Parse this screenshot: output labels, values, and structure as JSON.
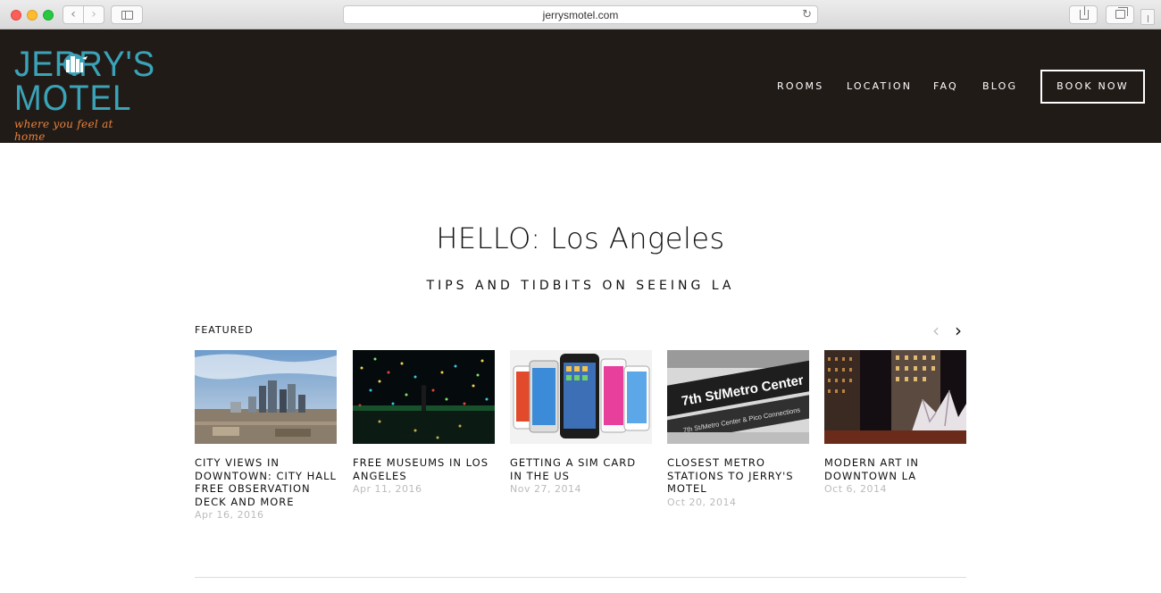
{
  "browser": {
    "url": "jerrysmotel.com",
    "back_icon": "chevron-left-icon",
    "forward_icon": "chevron-right-icon",
    "reload_icon": "reload-icon"
  },
  "site": {
    "logo": {
      "line1": "JERRY'S",
      "line2": "MOTEL",
      "tagline": "where you feel at home"
    },
    "nav": {
      "rooms": "ROOMS",
      "location": "LOCATION",
      "faq": "FAQ",
      "blog": "BLOG"
    },
    "book_now": "BOOK NOW",
    "colors": {
      "header_bg": "#211b18",
      "logo_teal": "#3aa3b8",
      "logo_orange": "#e8823a"
    }
  },
  "main": {
    "title": "HELLO: Los Angeles",
    "subtitle": "TIPS AND TIDBITS ON SEEING LA",
    "featured_label": "FEATURED",
    "prev_arrow": "‹",
    "next_arrow": "›",
    "posts": [
      {
        "title": "CITY VIEWS IN DOWNTOWN: CITY HALL FREE OBSERVATION DECK AND MORE",
        "date": "Apr 16, 2016",
        "image": "la-skyline-photo"
      },
      {
        "title": "FREE MUSEUMS IN LOS ANGELES",
        "date": "Apr 11, 2016",
        "image": "infinity-room-photo"
      },
      {
        "title": "GETTING A SIM CARD IN THE US",
        "date": "Nov 27, 2014",
        "image": "smartphones-photo"
      },
      {
        "title": "CLOSEST METRO STATIONS TO JERRY'S MOTEL",
        "date": "Oct 20, 2014",
        "image": "metro-sign-photo",
        "sign_text": "7th St/Metro Center",
        "sign_sub": "7th St/Metro Center & Pico Connections"
      },
      {
        "title": "MODERN ART IN DOWNTOWN LA",
        "date": "Oct 6, 2014",
        "image": "downtown-sculpture-photo"
      }
    ]
  }
}
